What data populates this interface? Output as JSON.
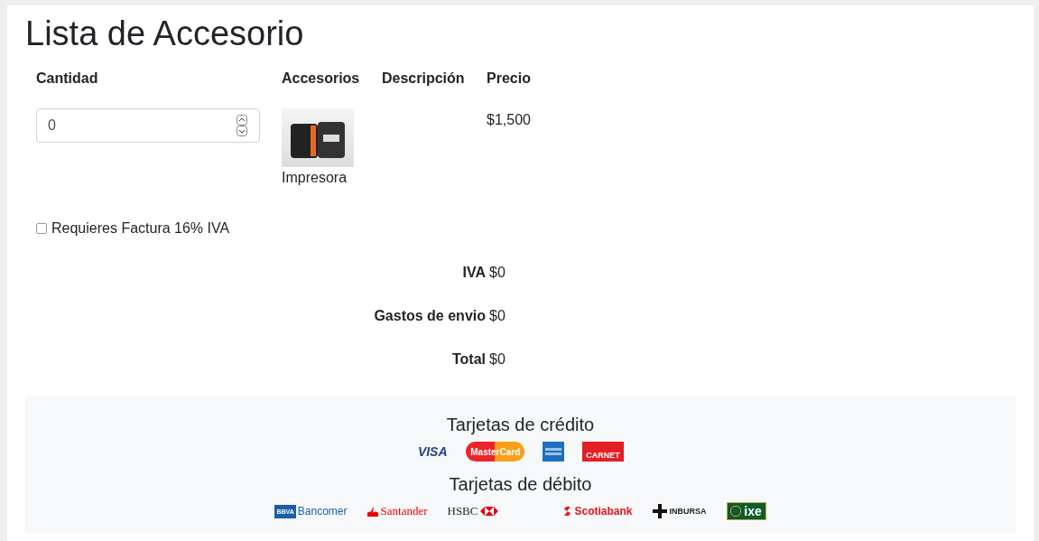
{
  "title": "Lista de Accesorio",
  "table": {
    "columns": [
      "Cantidad",
      "Accesorios",
      "Descripción",
      "Precio"
    ],
    "rows": [
      {
        "quantity": "0",
        "accessory": "Impresora",
        "price": "$1,500"
      }
    ]
  },
  "invoice": {
    "label": "Requieres Factura 16% IVA",
    "checked": false
  },
  "totals": [
    {
      "label": "IVA",
      "value": "$0"
    },
    {
      "label": "Gastos de envio",
      "value": "$0"
    },
    {
      "label": "Total",
      "value": "$0"
    }
  ],
  "payment": {
    "credit_title": "Tarjetas de crédito",
    "credit_cards": [
      {
        "kind": "visa",
        "text": "VISA"
      },
      {
        "kind": "mastercard",
        "text": "MasterCard"
      },
      {
        "kind": "amex"
      },
      {
        "kind": "carnet",
        "text": "CARNET"
      }
    ],
    "debit_title": "Tarjetas de débito",
    "debit_cards": [
      {
        "kind": "bancomer",
        "text": "Bancomer",
        "tag": "BBVA"
      },
      {
        "kind": "santander",
        "text": "Santander"
      },
      {
        "kind": "hsbc",
        "text": "HSBC"
      },
      {
        "kind": "scotiabank",
        "text": "Scotiabank"
      },
      {
        "kind": "inbursa",
        "text": "INBURSA"
      },
      {
        "kind": "ixe",
        "text": "ixe"
      }
    ]
  }
}
